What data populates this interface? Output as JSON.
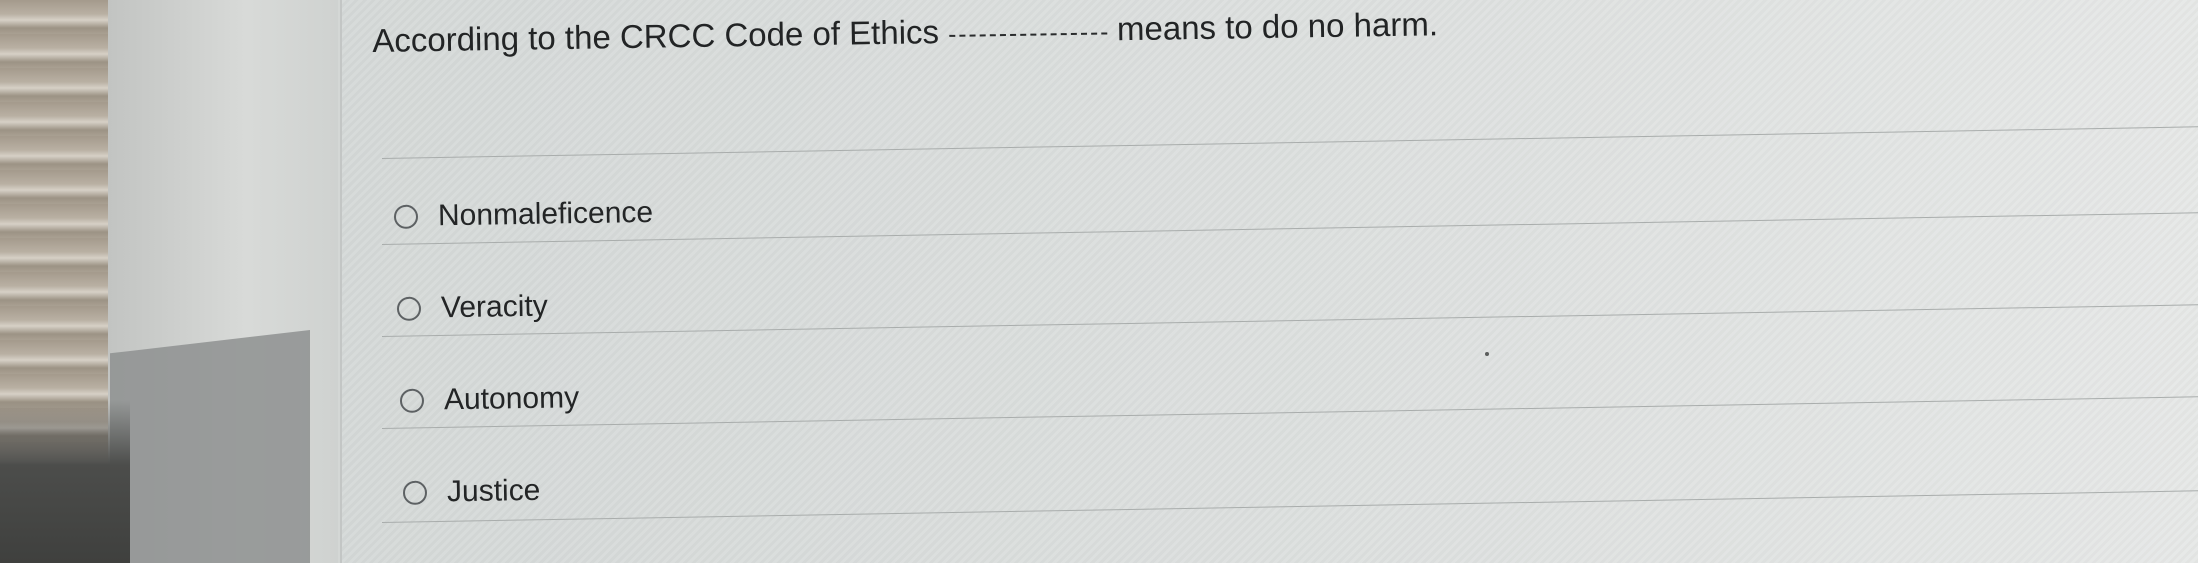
{
  "question": {
    "text_before": "According to the CRCC Code of Ethics",
    "blank": "",
    "text_after": "means to do no harm."
  },
  "options": [
    {
      "label": "Nonmaleficence",
      "selected": false
    },
    {
      "label": "Veracity",
      "selected": false
    },
    {
      "label": "Autonomy",
      "selected": false
    },
    {
      "label": "Justice",
      "selected": false
    }
  ],
  "colors": {
    "text": "#222425",
    "radio_border": "#5d6163",
    "panel_background": "#dde0df"
  },
  "icons": {
    "option_marker": "radio-button-unselected"
  }
}
